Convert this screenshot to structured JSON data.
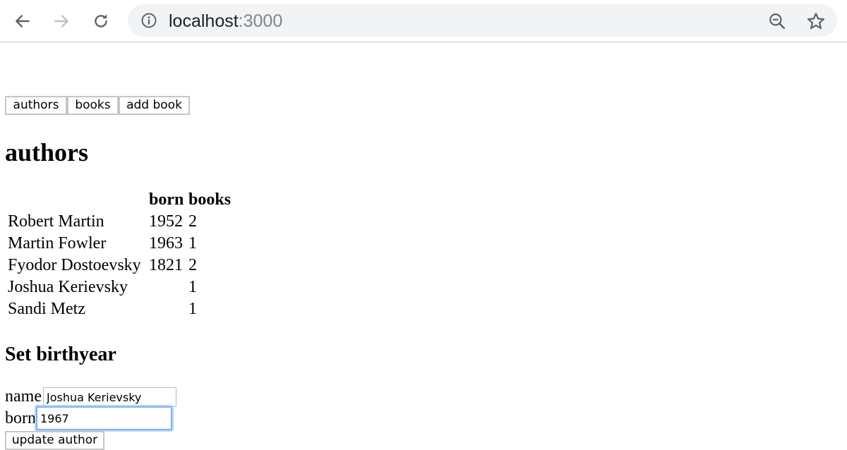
{
  "browser": {
    "url_host": "localhost",
    "url_port": ":3000",
    "icons": [
      "back-arrow-icon",
      "forward-arrow-icon",
      "reload-icon",
      "info-icon",
      "zoom-out-icon",
      "star-icon"
    ]
  },
  "menu": {
    "authors_label": "authors",
    "books_label": "books",
    "add_book_label": "add book"
  },
  "authors_view": {
    "title": "authors",
    "table": {
      "headers": [
        "",
        "born",
        "books"
      ],
      "rows": [
        {
          "name": "Robert Martin",
          "born": "1952",
          "books": "2"
        },
        {
          "name": "Martin Fowler",
          "born": "1963",
          "books": "1"
        },
        {
          "name": "Fyodor Dostoevsky",
          "born": "1821",
          "books": "2"
        },
        {
          "name": "Joshua Kerievsky",
          "born": "",
          "books": "1"
        },
        {
          "name": "Sandi Metz",
          "born": "",
          "books": "1"
        }
      ]
    }
  },
  "birthyear_form": {
    "title": "Set birthyear",
    "name_label": "name",
    "name_value": "Joshua Kerievsky",
    "born_label": "born",
    "born_value": "1967",
    "submit_label": "update author"
  },
  "colors": {
    "focus_ring": "#7eb5f3",
    "address_bar_bg": "#f1f3f4"
  }
}
